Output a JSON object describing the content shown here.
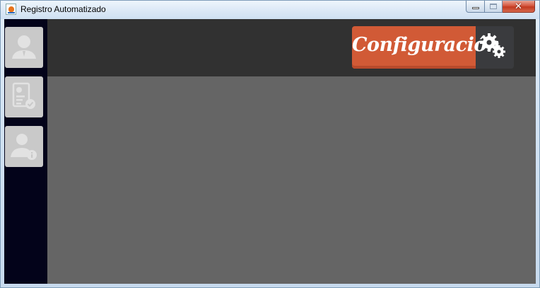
{
  "window": {
    "title": "Registro Automatizado",
    "close_glyph": "✕"
  },
  "sidebar": {
    "items": [
      {
        "icon": "user-icon"
      },
      {
        "icon": "clipboard-check-icon"
      },
      {
        "icon": "user-info-icon"
      }
    ]
  },
  "header": {
    "config_label": "Configuración",
    "config_icon": "gears-icon"
  },
  "colors": {
    "sidebar": "#03031a",
    "header": "#313131",
    "content": "#656565",
    "accent": "#d15a36",
    "sidebar_button": "#c9c9c9"
  }
}
